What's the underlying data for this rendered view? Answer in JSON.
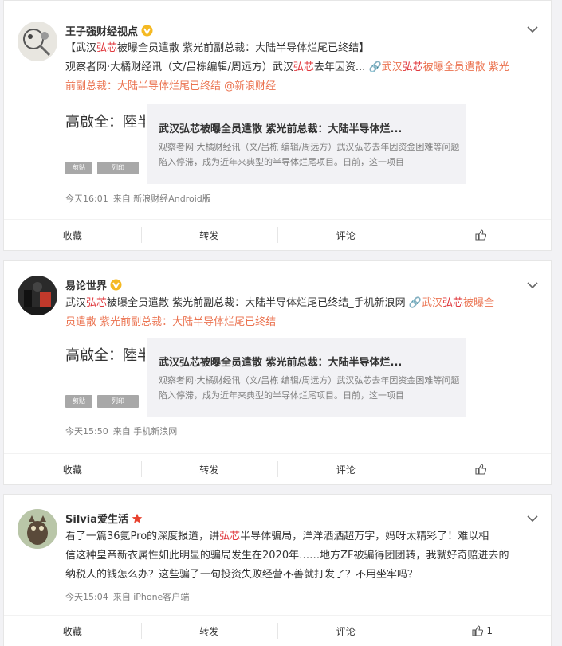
{
  "posts": [
    {
      "username": "王子强财经视点",
      "badge": "verified",
      "line1_pre": "【武汉",
      "line1_hl": "弘芯",
      "line1_post": "被曝全员遣散 紫光前副总裁：大陆半导体烂尾已终结】",
      "line2_pre": "观察者网·大橘财经讯（文/吕栋编辑/周远方）武汉",
      "line2_hl": "弘芯",
      "line2_post": "去年因资... ",
      "link1_pre": "🔗武汉",
      "link1_hl": "弘芯",
      "link1_post": "被曝全员遣散 紫光",
      "line3_link": "前副总裁：大陆半导体烂尾已终结",
      "line3_mention": " @新浪财经",
      "preview_bg_text": "高啟全：陸半",
      "btn_a": "剪貼",
      "btn_b": "列印",
      "card_title": "武汉弘芯被曝全员遣散 紫光前总裁：大陆半导体烂...",
      "card_desc": "观察者网·大橘财经讯（文/吕栋 编辑/周远方）武汉弘芯去年因资金困难等问题陷入停滞，成为近年来典型的半导体烂尾项目。日前，这一项目",
      "time": "今天16:01",
      "source": "来自 新浪财经Android版",
      "actions": [
        "收藏",
        "转发",
        "评论",
        ""
      ],
      "like_count": ""
    },
    {
      "username": "易论世界",
      "badge": "verified",
      "line1_pre": "武汉",
      "line1_hl": "弘芯",
      "line1_post": "被曝全员遣散 紫光前副总裁：大陆半导体烂尾已终结_手机新浪网 ",
      "link1_pre": "🔗武汉",
      "link1_hl": "弘芯",
      "link1_post": "被曝全",
      "line2_link": "员遣散 紫光前副总裁：大陆半导体烂尾已终结",
      "preview_bg_text": "高啟全：陸半",
      "btn_a": "剪貼",
      "btn_b": "列印",
      "card_title": "武汉弘芯被曝全员遣散 紫光前总裁：大陆半导体烂...",
      "card_desc": "观察者网·大橘财经讯（文/吕栋 编辑/周远方）武汉弘芯去年因资金困难等问题陷入停滞，成为近年来典型的半导体烂尾项目。日前，这一项目",
      "time": "今天15:50",
      "source": "来自 手机新浪网",
      "actions": [
        "收藏",
        "转发",
        "评论",
        ""
      ],
      "like_count": ""
    },
    {
      "username": "Silvia爱生活",
      "badge": "star",
      "line1_pre": "看了一篇36氪Pro的深度报道，讲",
      "line1_hl": "弘芯",
      "line1_post": "半导体骗局，洋洋洒洒超万字，妈呀太精彩了！难以相",
      "line2": "信这种皇帝新衣属性如此明显的骗局发生在2020年……地方ZF被骗得团团转，我就好奇赔进去的",
      "line3": "纳税人的钱怎么办？这些骗子一句投资失败经营不善就打发了？不用坐牢吗？",
      "time": "今天15:04",
      "source": "来自 iPhone客户端",
      "actions": [
        "收藏",
        "转发",
        "评论",
        ""
      ],
      "like_count": "1"
    }
  ],
  "colors": {
    "keyword": "#e0393e",
    "link": "#eb7350",
    "verified": "#f5b922",
    "star": "#e8412e"
  }
}
